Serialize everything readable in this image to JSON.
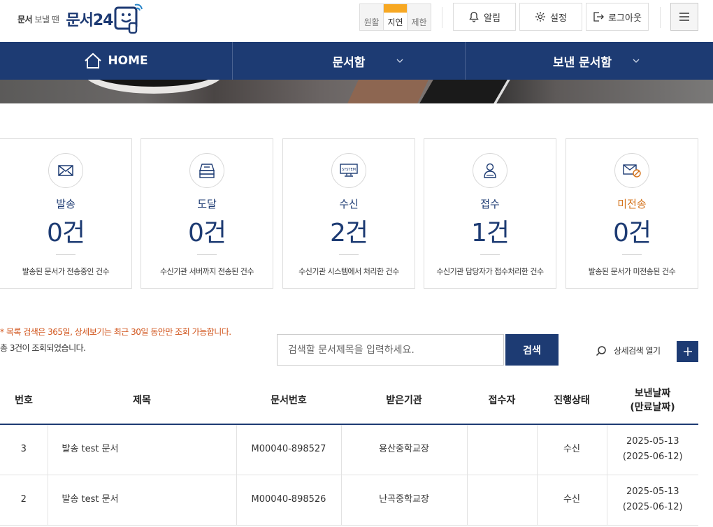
{
  "header": {
    "logo_prefix_bold": "문서",
    "logo_prefix": "보낼 땐",
    "logo_main": "문서24",
    "speed": [
      "원활",
      "지연",
      "제한"
    ],
    "speed_selected": "지연",
    "alert_label": "알림",
    "settings_label": "설정",
    "logout_label": "로그아웃"
  },
  "nav": {
    "home": "HOME",
    "inbox": "문서함",
    "sent": "보낸 문서함"
  },
  "colors": {
    "primary": "#1d3b73",
    "accent": "#f7a823",
    "warning": "#d4731c",
    "notice": "#d1541b"
  },
  "stats": [
    {
      "icon": "envelope-icon",
      "label": "발송",
      "count": "0건",
      "desc": "발송된 문서가 전송중인 건수"
    },
    {
      "icon": "server-icon",
      "label": "도달",
      "count": "0건",
      "desc": "수신기관 서버까지 전송된 건수"
    },
    {
      "icon": "system-monitor-icon",
      "label": "수신",
      "count": "2건",
      "desc": "수신기관 시스템에서 처리한 건수"
    },
    {
      "icon": "person-icon",
      "label": "접수",
      "count": "1건",
      "desc": "수신기관 담당자가 접수처리한 건수"
    },
    {
      "icon": "envelope-blocked-icon",
      "label": "미전송",
      "count": "0건",
      "desc": "발송된 문서가 미전송된 건수"
    }
  ],
  "search": {
    "notice": "* 목록 검색은 365일, 상세보기는 최근 30일 동안만 조회 가능합니다.",
    "total": "총 3건이 조회되었습니다.",
    "placeholder": "검색할 문서제목을 입력하세요.",
    "button": "검색",
    "advanced": "상세검색 열기"
  },
  "table": {
    "headers": [
      "번호",
      "제목",
      "문서번호",
      "받은기관",
      "접수자",
      "진행상태",
      "보낸날짜",
      "(만료날짜)"
    ],
    "rows": [
      {
        "no": "3",
        "title": "발송 test 문서",
        "doc_no": "M00040-898527",
        "org": "용산중학교장",
        "receiver": "",
        "status": "수신",
        "sent": "2025-05-13",
        "expire": "(2025-06-12)"
      },
      {
        "no": "2",
        "title": "발송 test 문서",
        "doc_no": "M00040-898526",
        "org": "난곡중학교장",
        "receiver": "",
        "status": "수신",
        "sent": "2025-05-13",
        "expire": "(2025-06-12)"
      }
    ]
  }
}
